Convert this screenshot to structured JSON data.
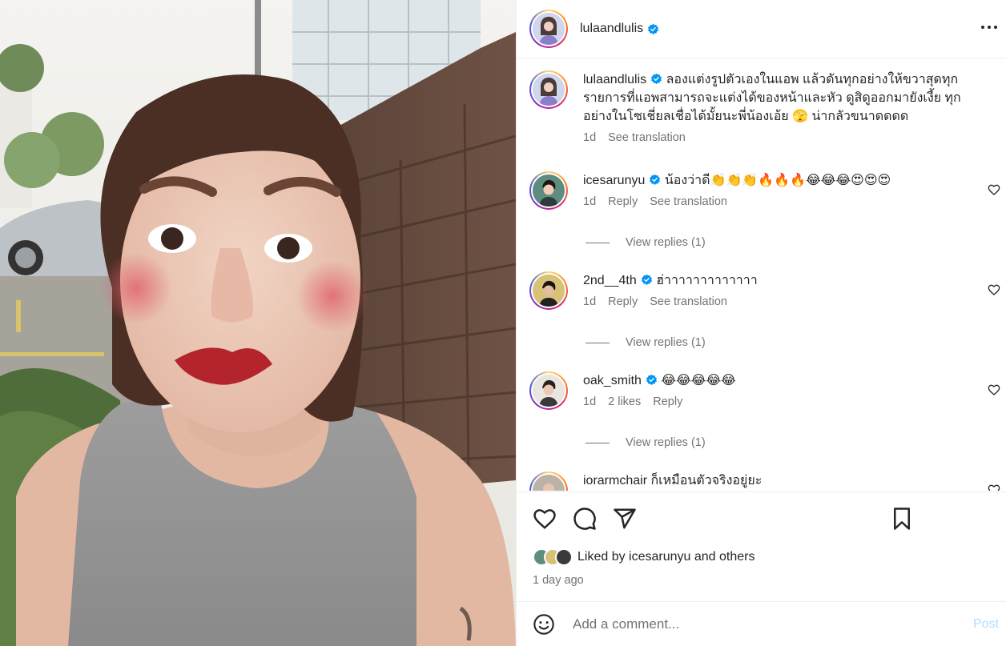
{
  "post": {
    "username": "lulaandlulis",
    "verified": true,
    "more_icon": "more-horizontal-icon"
  },
  "caption": {
    "username": "lulaandlulis",
    "text": "ลองแต่งรูปตัวเองในแอพ แล้วดันทุกอย่างให้ขวาสุดทุกรายการที่แอพสามารถจะแต่งได้ของหน้าและหัว ดูสิดูออกมายังเงี้ย ทุกอย่างในโซเชี่ยลเชื่อได้มั้ยนะพี่น้องเอ้ย 🫣 น่ากลัวขนาดดดด",
    "time": "1d",
    "translate": "See translation"
  },
  "comments": [
    {
      "username": "icesarunyu",
      "verified": true,
      "text": "น้องว่าดี👏👏👏🔥🔥🔥😂😂😂😍😍😍",
      "time": "1d",
      "actions": [
        "Reply",
        "See translation"
      ],
      "view_replies": "View replies (1)"
    },
    {
      "username": "2nd__4th",
      "verified": true,
      "text": "ฮ่าาาาาาาาาาาาา",
      "time": "1d",
      "actions": [
        "Reply",
        "See translation"
      ],
      "view_replies": "View replies (1)"
    },
    {
      "username": "oak_smith",
      "verified": true,
      "text": "😂😂😂😂😂",
      "time": "1d",
      "actions": [
        "2 likes",
        "Reply"
      ],
      "view_replies": "View replies (1)"
    },
    {
      "username": "iorarmchair",
      "verified": false,
      "text": "ก็เหมือนตัวจริงอยู่ยะ",
      "time": "",
      "actions": [],
      "view_replies": ""
    }
  ],
  "actions_bar": {
    "icons": [
      "heart-icon",
      "comment-icon",
      "share-icon",
      "bookmark-icon"
    ],
    "liked_by_prefix": "Liked by",
    "liked_by_user": "icesarunyu",
    "liked_by_and": "and",
    "liked_by_others": "others",
    "time_ago": "1 day ago"
  },
  "add_comment": {
    "placeholder": "Add a comment...",
    "post_label": "Post"
  },
  "colors": {
    "verified": "#0095f6",
    "text": "#262626",
    "muted": "#737373",
    "post_disabled": "#b3dbff"
  }
}
